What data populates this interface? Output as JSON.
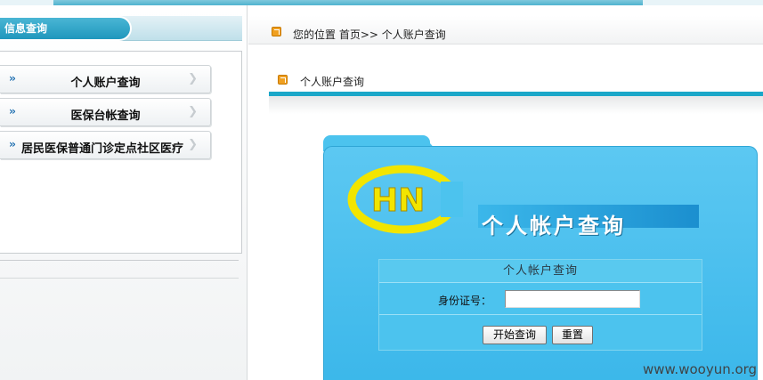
{
  "left_panel": {
    "tab_label": "信息查询",
    "menu": [
      {
        "label": "个人账户查询"
      },
      {
        "label": "医保台帐查询"
      },
      {
        "label": "居民医保普通门诊定点社区医疗"
      }
    ]
  },
  "breadcrumb": {
    "text": "您的位置 首页>> 个人账户查询"
  },
  "section": {
    "title": "个人账户查询"
  },
  "card": {
    "logo_text": "HN",
    "banner_title": "个人帐户查询",
    "form_title": "个人帐户查询",
    "id_label": "身份证号：",
    "id_value": "",
    "query_button": "开始查询",
    "reset_button": "重置"
  },
  "watermark": "www.wooyun.org",
  "colors": {
    "accent": "#1aa7c9",
    "card_bg": "#4cc3ee",
    "logo_yellow": "#f2e500"
  }
}
